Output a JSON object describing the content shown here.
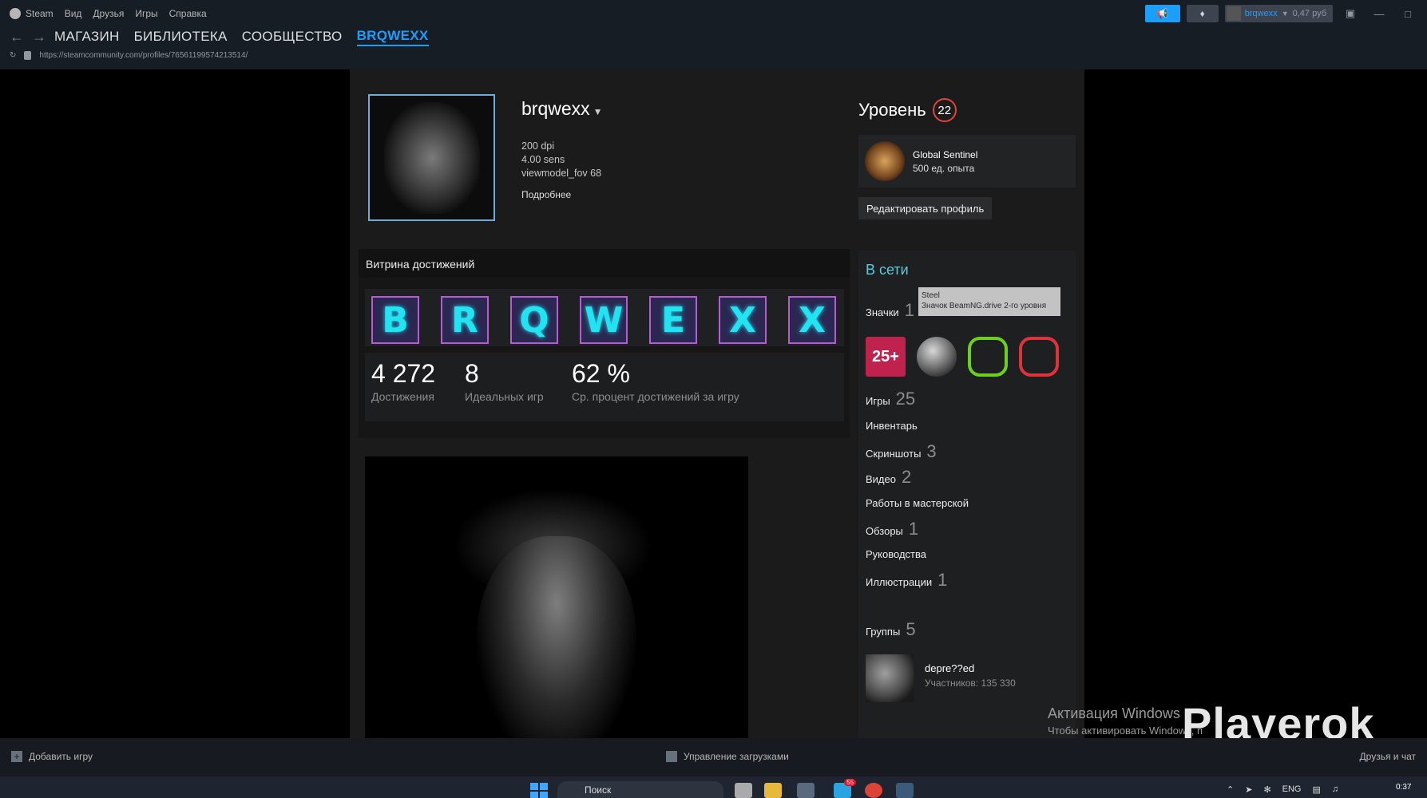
{
  "titlebar": {
    "app_name": "Steam",
    "menu": [
      "Вид",
      "Друзья",
      "Игры",
      "Справка"
    ],
    "user": {
      "name": "brqwexx",
      "balance": "0,47 руб"
    }
  },
  "nav": {
    "tabs": [
      "МАГАЗИН",
      "БИБЛИОТЕКА",
      "СООБЩЕСТВО",
      "BRQWEXX"
    ],
    "active_tab": "BRQWEXX",
    "url": "https://steamcommunity.com/profiles/76561199574213514/"
  },
  "profile": {
    "persona_name": "brqwexx",
    "summary": [
      "200 dpi",
      "4.00 sens",
      "viewmodel_fov 68"
    ],
    "more_link": "Подробнее",
    "level_label": "Уровень",
    "level": "22",
    "favorite_badge": {
      "name": "Global Sentinel",
      "xp": "500 ед. опыта"
    },
    "edit_button": "Редактировать профиль"
  },
  "showcase": {
    "title": "Витрина достижений",
    "letters": [
      "B",
      "R",
      "Q",
      "W",
      "E",
      "X",
      "X"
    ],
    "stats": [
      {
        "value": "4 272",
        "label": "Достижения"
      },
      {
        "value": "8",
        "label": "Идеальных игр"
      },
      {
        "value": "62 %",
        "label": "Ср. процент достижений за игру"
      }
    ]
  },
  "sidebar": {
    "status": "В сети",
    "badges_label": "Значки",
    "badges_count": "1",
    "badge_first_text": "25+",
    "tooltip": {
      "title": "Steel",
      "subtitle": "Значок BeamNG.drive 2-го уровня"
    },
    "items": [
      {
        "label": "Игры",
        "count": "25"
      },
      {
        "label": "Инвентарь",
        "count": ""
      },
      {
        "label": "Скриншоты",
        "count": "3"
      },
      {
        "label": "Видео",
        "count": "2"
      },
      {
        "label": "Работы в мастерской",
        "count": ""
      },
      {
        "label": "Обзоры",
        "count": "1"
      },
      {
        "label": "Руководства",
        "count": ""
      },
      {
        "label": "Иллюстрации",
        "count": "1"
      }
    ],
    "groups": {
      "label": "Группы",
      "count": "5",
      "first_name": "depre??ed",
      "first_members": "Участников: 135 330"
    }
  },
  "bottom": {
    "add_game": "Добавить игру",
    "downloads": "Управление загрузками",
    "friends": "Друзья и чат"
  },
  "overlay": {
    "activation_title": "Активация Windows",
    "activation_sub": "Чтобы активировать Windows, п",
    "watermark": "Playerok"
  },
  "taskbar": {
    "search": "Поиск",
    "lang": "ENG",
    "time": "0:37",
    "telegram_badge": "55"
  }
}
